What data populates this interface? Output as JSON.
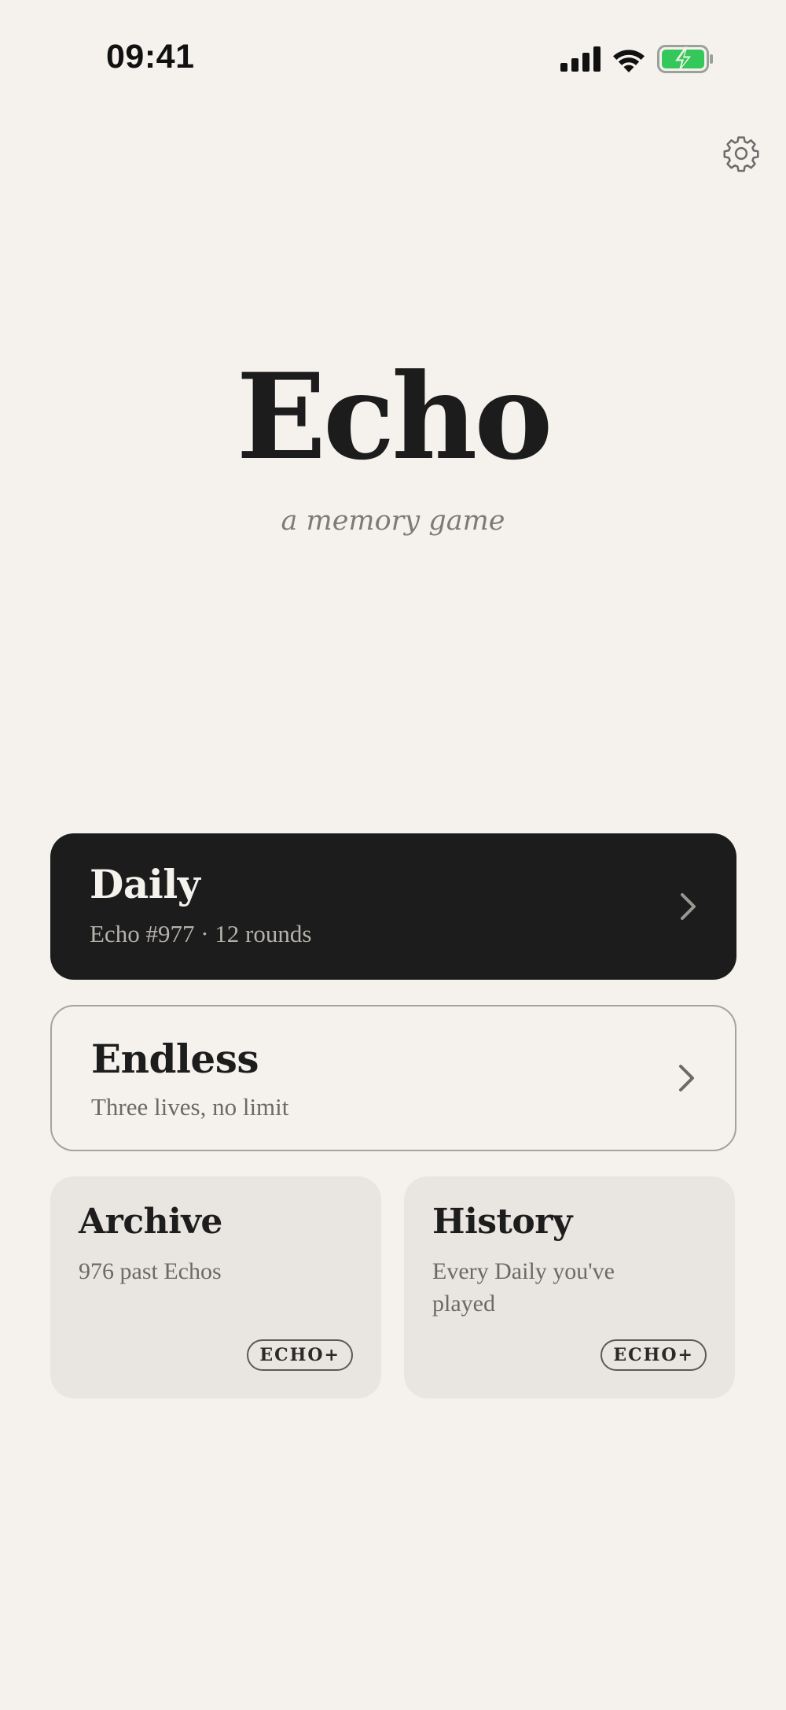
{
  "status_bar": {
    "time": "09:41",
    "icons": [
      "cellular-signal-icon",
      "wifi-icon",
      "battery-charging-icon"
    ],
    "battery_color": "#34c759"
  },
  "header": {
    "settings_icon": "gear-icon"
  },
  "hero": {
    "title": "Echo",
    "subtitle": "a memory game"
  },
  "modes": {
    "daily": {
      "title": "Daily",
      "subtitle": "Echo #977 · 12 rounds"
    },
    "endless": {
      "title": "Endless",
      "subtitle": "Three lives, no limit"
    }
  },
  "tiles": {
    "archive": {
      "title": "Archive",
      "subtitle": "976 past Echos",
      "badge": "ECHO+"
    },
    "history": {
      "title": "History",
      "subtitle": "Every Daily you've played",
      "badge": "ECHO+"
    }
  },
  "colors": {
    "background": "#f5f2ed",
    "primary_card": "#1c1c1c",
    "tile_background": "#e9e5e0",
    "muted_text": "#7e7a74"
  }
}
